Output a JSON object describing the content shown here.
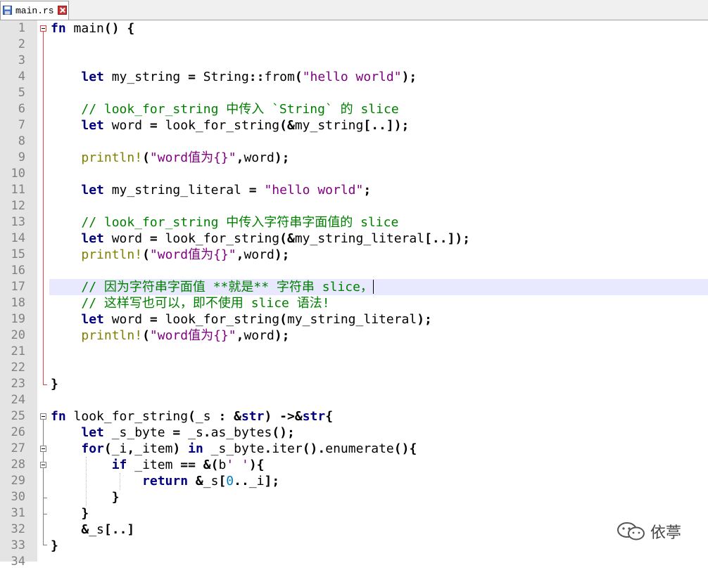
{
  "tabs": [
    {
      "label": "main.rs",
      "active": true,
      "modified": false
    }
  ],
  "icons": {
    "tab_save": "floppy-disk-icon",
    "tab_close": "close-icon",
    "watermark_logo": "wechat-icon"
  },
  "colors": {
    "keyword": "#000080",
    "string": "#800080",
    "comment": "#008000",
    "macro": "#808000",
    "number": "#0080c0",
    "current_line": "#e8e8ff",
    "fold_marker": "#e04040",
    "gutter_bg": "#e4e4e4"
  },
  "editor": {
    "language": "rust",
    "current_line": 17,
    "lines": [
      {
        "n": "1",
        "tokens": [
          [
            "kw",
            "fn"
          ],
          [
            "t",
            " main"
          ],
          [
            "p",
            "()"
          ],
          [
            "t",
            " "
          ],
          [
            "p",
            "{"
          ]
        ]
      },
      {
        "n": "2",
        "tokens": []
      },
      {
        "n": "3",
        "tokens": []
      },
      {
        "n": "4",
        "tokens": [
          [
            "t",
            "    "
          ],
          [
            "kw",
            "let"
          ],
          [
            "t",
            " my_string "
          ],
          [
            "p",
            "="
          ],
          [
            "t",
            " String"
          ],
          [
            "p",
            "::"
          ],
          [
            "t",
            "from"
          ],
          [
            "p",
            "("
          ],
          [
            "str",
            "\"hello world\""
          ],
          [
            "p",
            ");"
          ]
        ]
      },
      {
        "n": "5",
        "tokens": []
      },
      {
        "n": "6",
        "tokens": [
          [
            "t",
            "    "
          ],
          [
            "cmt",
            "// look_for_string 中传入 `String` 的 slice"
          ]
        ]
      },
      {
        "n": "7",
        "tokens": [
          [
            "t",
            "    "
          ],
          [
            "kw",
            "let"
          ],
          [
            "t",
            " word "
          ],
          [
            "p",
            "="
          ],
          [
            "t",
            " look_for_string"
          ],
          [
            "p",
            "(&"
          ],
          [
            "t",
            "my_string"
          ],
          [
            "p",
            "[..]);"
          ]
        ]
      },
      {
        "n": "8",
        "tokens": []
      },
      {
        "n": "9",
        "tokens": [
          [
            "t",
            "    "
          ],
          [
            "mac",
            "println!"
          ],
          [
            "p",
            "("
          ],
          [
            "str",
            "\"word值为{}\""
          ],
          [
            "p",
            ","
          ],
          [
            "t",
            "word"
          ],
          [
            "p",
            ");"
          ]
        ]
      },
      {
        "n": "10",
        "tokens": []
      },
      {
        "n": "11",
        "tokens": [
          [
            "t",
            "    "
          ],
          [
            "kw",
            "let"
          ],
          [
            "t",
            " my_string_literal "
          ],
          [
            "p",
            "="
          ],
          [
            "t",
            " "
          ],
          [
            "str",
            "\"hello world\""
          ],
          [
            "p",
            ";"
          ]
        ]
      },
      {
        "n": "12",
        "tokens": []
      },
      {
        "n": "13",
        "tokens": [
          [
            "t",
            "    "
          ],
          [
            "cmt",
            "// look_for_string 中传入字符串字面值的 slice"
          ]
        ]
      },
      {
        "n": "14",
        "tokens": [
          [
            "t",
            "    "
          ],
          [
            "kw",
            "let"
          ],
          [
            "t",
            " word "
          ],
          [
            "p",
            "="
          ],
          [
            "t",
            " look_for_string"
          ],
          [
            "p",
            "(&"
          ],
          [
            "t",
            "my_string_literal"
          ],
          [
            "p",
            "[..]);"
          ]
        ]
      },
      {
        "n": "15",
        "tokens": [
          [
            "t",
            "    "
          ],
          [
            "mac",
            "println!"
          ],
          [
            "p",
            "("
          ],
          [
            "str",
            "\"word值为{}\""
          ],
          [
            "p",
            ","
          ],
          [
            "t",
            "word"
          ],
          [
            "p",
            ");"
          ]
        ]
      },
      {
        "n": "16",
        "tokens": []
      },
      {
        "n": "17",
        "tokens": [
          [
            "t",
            "    "
          ],
          [
            "cmt",
            "// 因为字符串字面值 **就是** 字符串 slice，"
          ]
        ]
      },
      {
        "n": "18",
        "tokens": [
          [
            "t",
            "    "
          ],
          [
            "cmt",
            "// 这样写也可以，即不使用 slice 语法!"
          ]
        ]
      },
      {
        "n": "19",
        "tokens": [
          [
            "t",
            "    "
          ],
          [
            "kw",
            "let"
          ],
          [
            "t",
            " word "
          ],
          [
            "p",
            "="
          ],
          [
            "t",
            " look_for_string"
          ],
          [
            "p",
            "("
          ],
          [
            "t",
            "my_string_literal"
          ],
          [
            "p",
            ");"
          ]
        ]
      },
      {
        "n": "20",
        "tokens": [
          [
            "t",
            "    "
          ],
          [
            "mac",
            "println!"
          ],
          [
            "p",
            "("
          ],
          [
            "str",
            "\"word值为{}\""
          ],
          [
            "p",
            ","
          ],
          [
            "t",
            "word"
          ],
          [
            "p",
            ");"
          ]
        ]
      },
      {
        "n": "21",
        "tokens": []
      },
      {
        "n": "22",
        "tokens": []
      },
      {
        "n": "23",
        "tokens": [
          [
            "p",
            "}"
          ]
        ]
      },
      {
        "n": "24",
        "tokens": []
      },
      {
        "n": "25",
        "tokens": [
          [
            "kw",
            "fn"
          ],
          [
            "t",
            " look_for_string"
          ],
          [
            "p",
            "("
          ],
          [
            "t",
            "_s "
          ],
          [
            "p",
            ":"
          ],
          [
            "t",
            " "
          ],
          [
            "p",
            "&"
          ],
          [
            "kw",
            "str"
          ],
          [
            "p",
            ")"
          ],
          [
            "t",
            " "
          ],
          [
            "p",
            "->&"
          ],
          [
            "kw",
            "str"
          ],
          [
            "p",
            "{"
          ]
        ]
      },
      {
        "n": "26",
        "tokens": [
          [
            "t",
            "    "
          ],
          [
            "kw",
            "let"
          ],
          [
            "t",
            " _s_byte "
          ],
          [
            "p",
            "="
          ],
          [
            "t",
            " _s"
          ],
          [
            "p",
            "."
          ],
          [
            "t",
            "as_bytes"
          ],
          [
            "p",
            "();"
          ]
        ]
      },
      {
        "n": "27",
        "tokens": [
          [
            "t",
            "    "
          ],
          [
            "kw",
            "for"
          ],
          [
            "p",
            "("
          ],
          [
            "t",
            "_i"
          ],
          [
            "p",
            ","
          ],
          [
            "t",
            "_item"
          ],
          [
            "p",
            ")"
          ],
          [
            "t",
            " "
          ],
          [
            "kw",
            "in"
          ],
          [
            "t",
            " _s_byte"
          ],
          [
            "p",
            "."
          ],
          [
            "t",
            "iter"
          ],
          [
            "p",
            "()."
          ],
          [
            "t",
            "enumerate"
          ],
          [
            "p",
            "(){"
          ]
        ]
      },
      {
        "n": "28",
        "tokens": [
          [
            "t",
            "        "
          ],
          [
            "kw",
            "if"
          ],
          [
            "t",
            " _item "
          ],
          [
            "p",
            "=="
          ],
          [
            "t",
            " "
          ],
          [
            "p",
            "&("
          ],
          [
            "t",
            "b"
          ],
          [
            "str",
            "' '"
          ],
          [
            "p",
            "){"
          ]
        ]
      },
      {
        "n": "29",
        "tokens": [
          [
            "t",
            "            "
          ],
          [
            "kw",
            "return"
          ],
          [
            "t",
            " "
          ],
          [
            "p",
            "&"
          ],
          [
            "t",
            "_s"
          ],
          [
            "p",
            "["
          ],
          [
            "num",
            "0"
          ],
          [
            "p",
            ".."
          ],
          [
            "t",
            "_i"
          ],
          [
            "p",
            "];"
          ]
        ]
      },
      {
        "n": "30",
        "tokens": [
          [
            "t",
            "        "
          ],
          [
            "p",
            "}"
          ]
        ]
      },
      {
        "n": "31",
        "tokens": [
          [
            "t",
            "    "
          ],
          [
            "p",
            "}"
          ]
        ]
      },
      {
        "n": "32",
        "tokens": [
          [
            "t",
            "    "
          ],
          [
            "p",
            "&"
          ],
          [
            "t",
            "_s"
          ],
          [
            "p",
            "[..]"
          ]
        ]
      },
      {
        "n": "33",
        "tokens": [
          [
            "p",
            "}"
          ]
        ]
      },
      {
        "n": "34",
        "tokens": []
      }
    ]
  },
  "watermark": {
    "text": "依葶"
  }
}
